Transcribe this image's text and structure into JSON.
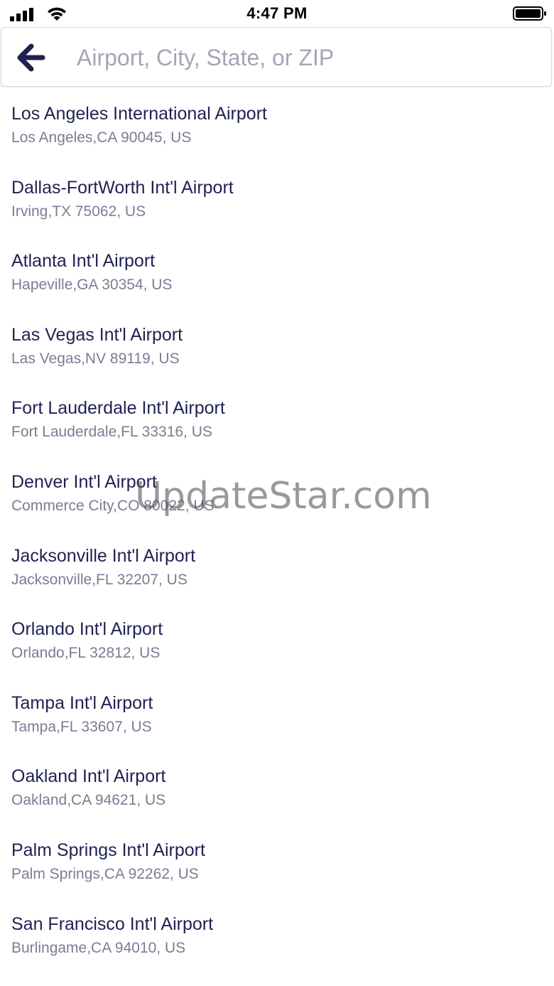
{
  "status_bar": {
    "time": "4:47 PM",
    "signal_icon": "cellular-signal-icon",
    "wifi_icon": "wifi-icon",
    "battery_icon": "battery-full-icon"
  },
  "search": {
    "back_icon": "arrow-left-icon",
    "placeholder": "Airport, City, State, or ZIP",
    "value": ""
  },
  "colors": {
    "primary_text": "#1f2153",
    "secondary_text": "#7a7d92",
    "placeholder": "#a3a5b8"
  },
  "airports": [
    {
      "name": "Los Angeles International Airport",
      "address": "Los Angeles,CA 90045, US"
    },
    {
      "name": "Dallas-FortWorth Int'l Airport",
      "address": "Irving,TX 75062, US"
    },
    {
      "name": "Atlanta Int'l Airport",
      "address": "Hapeville,GA 30354, US"
    },
    {
      "name": "Las Vegas Int'l Airport",
      "address": "Las Vegas,NV 89119, US"
    },
    {
      "name": "Fort Lauderdale Int'l Airport",
      "address": "Fort Lauderdale,FL 33316, US"
    },
    {
      "name": "Denver Int'l Airport",
      "address": "Commerce City,CO 80022, US"
    },
    {
      "name": "Jacksonville Int'l Airport",
      "address": "Jacksonville,FL 32207, US"
    },
    {
      "name": "Orlando Int'l Airport",
      "address": "Orlando,FL 32812, US"
    },
    {
      "name": "Tampa Int'l Airport",
      "address": "Tampa,FL 33607, US"
    },
    {
      "name": "Oakland Int'l Airport",
      "address": "Oakland,CA 94621, US"
    },
    {
      "name": "Palm Springs Int'l Airport",
      "address": "Palm Springs,CA 92262, US"
    },
    {
      "name": "San Francisco Int'l Airport",
      "address": "Burlingame,CA 94010, US"
    }
  ],
  "watermark": "UpdateStar.com"
}
